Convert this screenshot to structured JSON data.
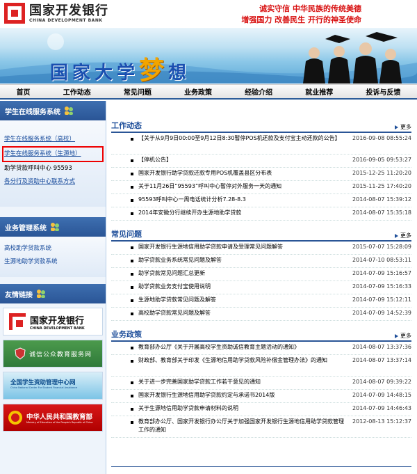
{
  "header": {
    "logo_cn": "国家开发银行",
    "logo_en": "CHINA DEVELOPMENT BANK",
    "slogan_line1": "诚实守信  中华民族的传统美德",
    "slogan_line2": "增强国力  改善民生  开行的神圣使命",
    "banner_title_a": "国家大学",
    "banner_title_dream": "梦",
    "banner_title_b": "想"
  },
  "nav": [
    "首页",
    "工作动态",
    "常见问题",
    "业务政策",
    "经验介绍",
    "就业推荐",
    "投诉与反馈"
  ],
  "sidebar": {
    "student_title": "学生在线服务系统",
    "student_items": [
      "学生在线服务系统（高校）",
      "学生在线服务系统（生源地）",
      "助学贷款呼叫中心 95593",
      "各分行及资助中心联系方式"
    ],
    "business_title": "业务管理系统",
    "business_items": [
      "高校助学贷款系统",
      "生源地助学贷款系统"
    ],
    "links_title": "友情链接",
    "partner1_cn": "国家开发银行",
    "partner1_en": "CHINA DEVELOPMENT BANK",
    "partner2": "诚信公众教育服务网",
    "partner3": "全国学生资助管理中心网",
    "partner3_en": "China National Center For Student Financial Assistance",
    "partner4": "中华人民共和国教育部",
    "partner4_en": "Ministry of Education of the People's Republic of China"
  },
  "more_label": "更多",
  "sections": [
    {
      "title": "工作动态",
      "rows": [
        {
          "text": "【关于从9月9日00:00至9月12日8:30暂停POS机还款及支付宝主动还款的公告】",
          "date": "2016-09-08 08:55:24",
          "tall": true
        },
        {
          "text": "【停机公告】",
          "date": "2016-09-05 09:53:27"
        },
        {
          "text": "国家开发银行助学贷款还款专用POS机覆盖县区分布表",
          "date": "2015-12-25 11:20:20"
        },
        {
          "text": "关于11月26日“95593”呼叫中心暂停对外服务一天的通知",
          "date": "2015-11-25 17:40:20"
        },
        {
          "text": "95593呼叫中心一周电话统计分析7.28-8.3",
          "date": "2014-08-07 15:39:12"
        },
        {
          "text": "2014年安徽分行继续开办生源地助学贷款",
          "date": "2014-08-07 15:35:18"
        }
      ]
    },
    {
      "title": "常见问题",
      "rows": [
        {
          "text": "国家开发银行生源地信用助学贷款申请及受理常见问题解答",
          "date": "2015-07-07 15:28:09"
        },
        {
          "text": "助学贷款业务系统常见问题及解答",
          "date": "2014-07-10 08:53:11"
        },
        {
          "text": "助学贷款常见问题汇总更新",
          "date": "2014-07-09 15:16:57"
        },
        {
          "text": "助学贷款业务支付宝使用说明",
          "date": "2014-07-09 15:16:33"
        },
        {
          "text": "生源地助学贷款常见问题及解答",
          "date": "2014-07-09 15:12:11"
        },
        {
          "text": "高校助学贷款常见问题及解答",
          "date": "2014-07-09 14:52:39"
        }
      ]
    },
    {
      "title": "业务政策",
      "rows": [
        {
          "text": "教育部办公厅《关于开展高校学生资助诚信教育主题活动的通知》",
          "date": "2014-08-07 13:37:36"
        },
        {
          "text": "财政部、教育部关于印发《生源地信用助学贷款风险补偿金管理办法》的通知",
          "date": "2014-08-07 13:37:14",
          "tall": true
        },
        {
          "text": "关于进一步完善国家助学贷款工作若干意见的通知",
          "date": "2014-08-07 09:39:22"
        },
        {
          "text": "国家开发银行生源地信用助学贷款约定与承诺书2014版",
          "date": "2014-07-09 14:48:15"
        },
        {
          "text": "关于生源地信用助学贷款申请材料的说明",
          "date": "2014-07-09 14:46:43"
        },
        {
          "text": "教育部办公厅、国家开发银行办公厅关于加强国家开发银行生源地信用助学贷款管理工作的通知",
          "date": "2012-08-13 15:12:37",
          "tall": true
        }
      ]
    }
  ]
}
